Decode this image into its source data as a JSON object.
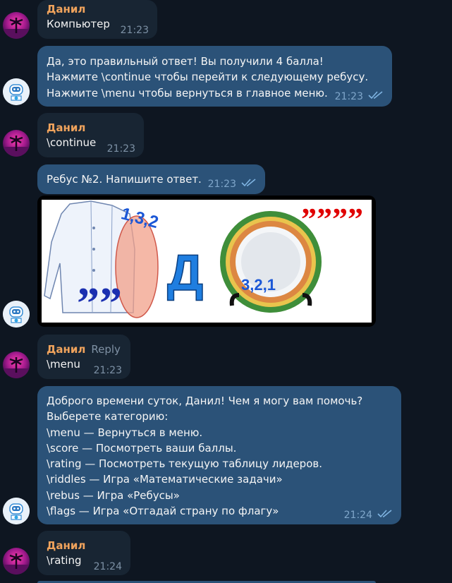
{
  "messages": [
    {
      "sender": "Данил",
      "text": "Компьютер",
      "time": "21:23"
    },
    {
      "lines": [
        "Да, это правильный ответ! Вы получили 4 балла!",
        "Нажмите \\continue чтобы перейти к следующему ребусу.",
        "Нажмите \\menu чтобы вернуться в главное меню."
      ],
      "time": "21:23"
    },
    {
      "sender": "Данил",
      "text": "\\continue",
      "time": "21:23"
    },
    {
      "text": "Ребус №2. Напишите ответ.",
      "time": "21:23"
    },
    {
      "sender": "Данил",
      "reply_label": "Reply",
      "text": "\\menu",
      "time": "21:23"
    },
    {
      "lines": [
        "Доброго времени суток, Данил! Чем я могу вам помочь?",
        "Выберете категорию:",
        "\\menu — Вернуться в меню.",
        "\\score — Посмотреть ваши баллы.",
        "\\rating — Посмотреть текущую таблицу лидеров.",
        "\\riddles — Игра «Математические задачи»",
        "\\rebus — Игра «Ребусы»",
        "\\flags — Игра «Отгадай страну по флагу»"
      ],
      "time": "21:24"
    },
    {
      "sender": "Данил",
      "text": "\\rating",
      "time": "21:24"
    }
  ],
  "rebus": {
    "label_top": "1,3,2",
    "letter": "Д",
    "label_plate": "3,2,1",
    "commas_right": "””””",
    "commas_left": "””"
  },
  "icons": {
    "user_avatar": "synthwave-palm-avatar",
    "bot_avatar": "robot-avatar",
    "read": "double-check-icon"
  },
  "colors": {
    "background": "#0e1621",
    "incoming": "#182533",
    "outgoing": "#2b5278",
    "sender_name": "#f0a35c"
  }
}
